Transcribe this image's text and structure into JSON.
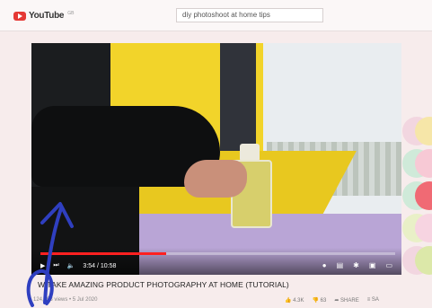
{
  "header": {
    "logo_text": "YouTube",
    "logo_sup": "GB",
    "search_value": "diy photoshoot at home tips"
  },
  "player": {
    "time": "3:54 / 10:58",
    "progress_fraction": 0.355
  },
  "video": {
    "title": "W  TAKE AMAZING PRODUCT PHOTOGRAPHY AT HOME (TUTORIAL)",
    "meta": "124,693 views • 5 Jul 2020",
    "likes": "4.3K",
    "dislikes": "63",
    "share": "SHARE",
    "save_partial": "SA"
  },
  "colors": {
    "dots": [
      "#f2d6e0",
      "#f6e6a8",
      "#cfead9",
      "#f7c9d5",
      "#cfead9",
      "#f06a74",
      "#e9f0c7",
      "#f7d4e1",
      "#f2d6e0",
      "#dce8a9"
    ]
  }
}
